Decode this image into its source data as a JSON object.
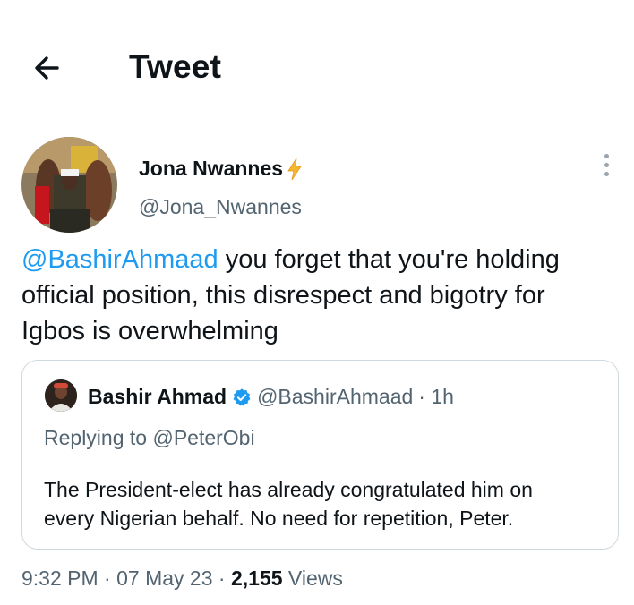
{
  "header": {
    "title": "Tweet",
    "back_icon": "arrow-left-icon"
  },
  "author": {
    "name": "Jona Nwannes",
    "emoji": "lightning-bolt-icon",
    "handle": "@Jona_Nwannes"
  },
  "tweet": {
    "mention": "@BashirAhmaad",
    "line1_rest": " you forget that you're holding",
    "line2": "official position, this disrespect and bigotry for",
    "line3": "Igbos is overwhelming"
  },
  "quoted": {
    "name": "Bashir Ahmad",
    "verified": true,
    "handle": "@BashirAhmaad",
    "time": "· 1h",
    "reply_prefix": "Replying to ",
    "reply_to": "@PeterObi",
    "line1": "The President-elect has already congratulated him on",
    "line2": "every Nigerian behalf. No need for repetition, Peter."
  },
  "meta": {
    "time": "9:32 PM",
    "sep1": " · ",
    "date": "07 May 23",
    "sep2": " · ",
    "views_count": "2,155",
    "views_label": " Views"
  },
  "colors": {
    "link": "#1d9bf0",
    "muted": "#536471",
    "text": "#0f1419",
    "border": "#cfd9de"
  }
}
